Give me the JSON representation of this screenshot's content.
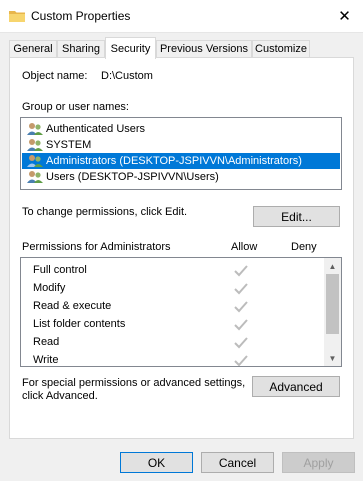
{
  "window": {
    "title": "Custom Properties",
    "close_glyph": "✕"
  },
  "tabs": [
    "General",
    "Sharing",
    "Security",
    "Previous Versions",
    "Customize"
  ],
  "object": {
    "label": "Object name:",
    "value": "D:\\Custom"
  },
  "groups": {
    "label": "Group or user names:",
    "items": [
      "Authenticated Users",
      "SYSTEM",
      "Administrators (DESKTOP-JSPIVVN\\Administrators)",
      "Users (DESKTOP-JSPIVVN\\Users)"
    ],
    "selected_index": 2
  },
  "change_text": "To change permissions, click Edit.",
  "edit_button": "Edit...",
  "permissions": {
    "label": "Permissions for Administrators",
    "allow_header": "Allow",
    "deny_header": "Deny",
    "items": [
      "Full control",
      "Modify",
      "Read & execute",
      "List folder contents",
      "Read",
      "Write"
    ]
  },
  "special": {
    "line1": "For special permissions or advanced settings,",
    "line2": "click Advanced.",
    "button": "Advanced"
  },
  "footer": {
    "ok": "OK",
    "cancel": "Cancel",
    "apply": "Apply"
  },
  "colors": {
    "selection": "#0078d7",
    "check": "#bcbcbc"
  }
}
